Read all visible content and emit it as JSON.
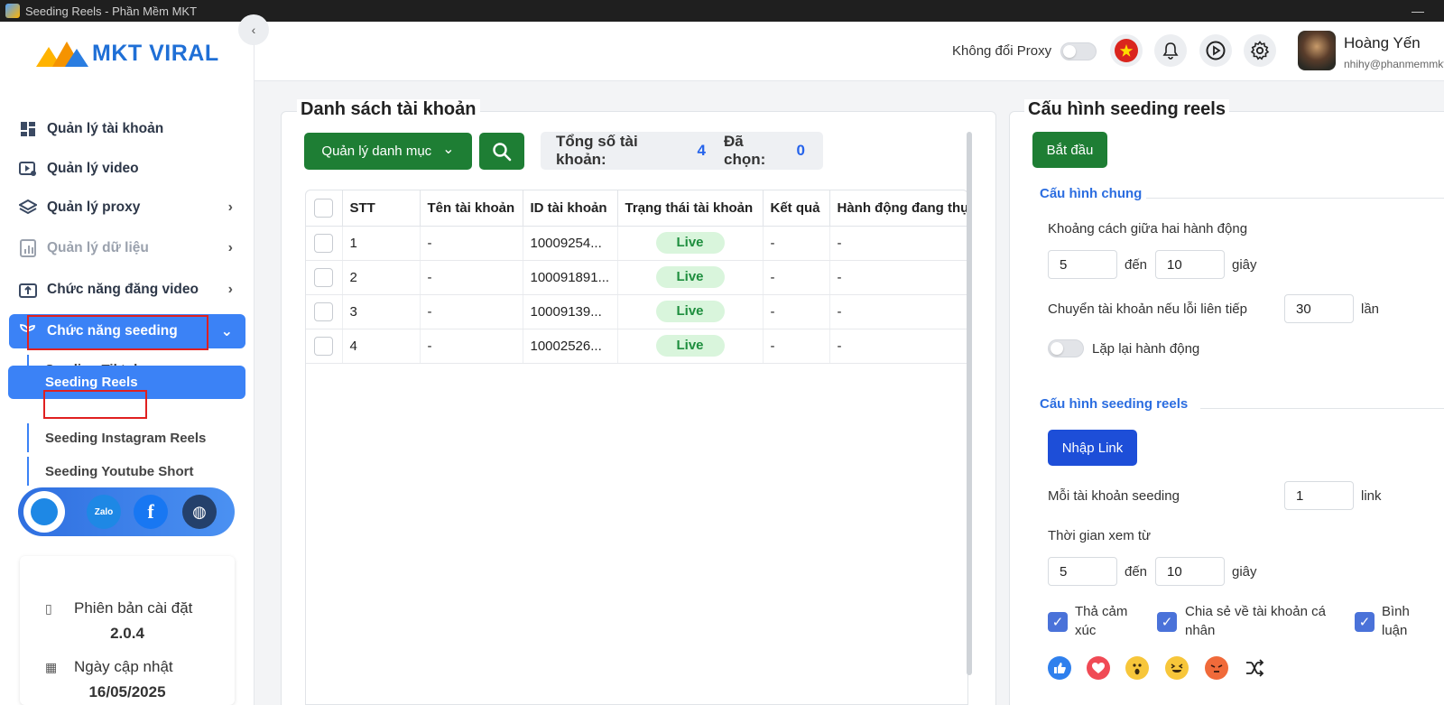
{
  "window": {
    "title": "Seeding Reels - Phần Mềm MKT",
    "minimize": "—"
  },
  "brand": {
    "logo_text": "MKT VIRAL"
  },
  "sidebar": {
    "collapse_icon": "‹",
    "items": [
      {
        "label": "Quản lý tài khoản",
        "icon": "grid-icon"
      },
      {
        "label": "Quản lý video",
        "icon": "video-settings-icon"
      },
      {
        "label": "Quản lý proxy",
        "icon": "layers-icon"
      },
      {
        "label": "Quản lý dữ liệu",
        "icon": "chart-icon"
      },
      {
        "label": "Chức năng đăng video",
        "icon": "upload-icon"
      },
      {
        "label": "Chức năng seeding",
        "icon": "seedling-icon"
      }
    ],
    "chevron": "›",
    "chevron_down": "⌄",
    "sub_items": [
      {
        "label": "Seeding Tiktok"
      },
      {
        "label": "Seeding Reels"
      },
      {
        "label": "Seeding Instagram Reels"
      },
      {
        "label": "Seeding Youtube Short"
      }
    ],
    "social": {
      "zalo": "Zalo",
      "facebook": "f",
      "web": "◍"
    },
    "info": {
      "version_label": "Phiên bản cài đặt",
      "version": "2.0.4",
      "update_label": "Ngày cập nhật",
      "update_date": "16/05/2025"
    }
  },
  "header": {
    "proxy_label": "Không đổi Proxy",
    "user_name": "Hoàng Yến",
    "user_email": "nhihy@phanmemmkt.vn"
  },
  "accounts": {
    "title": "Danh sách tài khoản",
    "category_button": "Quản lý danh mục",
    "category_chevron": "⌄",
    "total_label": "Tổng số tài khoản:",
    "total": "4",
    "selected_label": "Đã chọn:",
    "selected": "0",
    "columns": [
      "STT",
      "Tên tài khoản",
      "ID tài khoản",
      "Trạng thái tài khoản",
      "Kết quả",
      "Hành động đang thực hiện"
    ],
    "rows": [
      {
        "stt": "1",
        "name": "-",
        "id": "10009254...",
        "status": "Live",
        "result": "-",
        "action": "-"
      },
      {
        "stt": "2",
        "name": "-",
        "id": "100091891...",
        "status": "Live",
        "result": "-",
        "action": "-"
      },
      {
        "stt": "3",
        "name": "-",
        "id": "10009139...",
        "status": "Live",
        "result": "-",
        "action": "-"
      },
      {
        "stt": "4",
        "name": "-",
        "id": "10002526...",
        "status": "Live",
        "result": "-",
        "action": "-"
      }
    ]
  },
  "config": {
    "title": "Cấu hình seeding reels",
    "start_button": "Bắt đầu",
    "general_section": "Cấu hình chung",
    "interval_label": "Khoảng cách giữa hai hành động",
    "interval_from": "5",
    "to_label": "đến",
    "interval_to": "10",
    "seconds_label": "giây",
    "switch_label": "Chuyển tài khoản nếu lỗi liên tiếp",
    "switch_value": "30",
    "times_label": "lần",
    "repeat_label": "Lặp lại hành động",
    "reels_section": "Cấu hình seeding reels",
    "import_button": "Nhập Link",
    "per_account_label": "Mỗi tài khoản seeding",
    "per_account_value": "1",
    "link_label": "link",
    "watch_label": "Thời gian xem từ",
    "watch_from": "5",
    "watch_to": "10",
    "react_label_1": "Thả cảm",
    "react_label_2": "xúc",
    "share_label_1": "Chia sẻ về tài khoản cá",
    "share_label_2": "nhân",
    "comment_label_1": "Bình",
    "comment_label_2": "luận",
    "check_mark": "✓"
  },
  "colors": {
    "accent": "#3b82f6",
    "green": "#1e7e34",
    "blue": "#1d4ed8",
    "live_bg": "#d9f5dc",
    "live_text": "#1e8e3e"
  }
}
